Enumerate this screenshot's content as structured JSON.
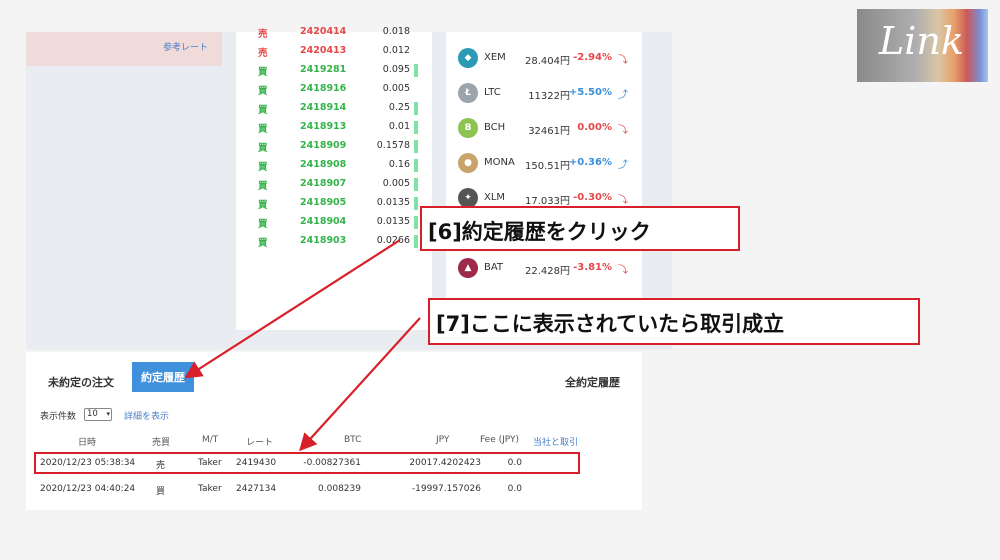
{
  "header_card": {
    "ref_label": "参考レート"
  },
  "recent_trades": [
    {
      "side": "売",
      "type": "sell",
      "price": "2420414",
      "qty": "0.018",
      "bar": false
    },
    {
      "side": "売",
      "type": "sell",
      "price": "2420413",
      "qty": "0.012",
      "bar": false
    },
    {
      "side": "買",
      "type": "buy",
      "price": "2419281",
      "qty": "0.095",
      "bar": true
    },
    {
      "side": "買",
      "type": "buy",
      "price": "2418916",
      "qty": "0.005",
      "bar": false
    },
    {
      "side": "買",
      "type": "buy",
      "price": "2418914",
      "qty": "0.25",
      "bar": true
    },
    {
      "side": "買",
      "type": "buy",
      "price": "2418913",
      "qty": "0.01",
      "bar": true
    },
    {
      "side": "買",
      "type": "buy",
      "price": "2418909",
      "qty": "0.1578",
      "bar": true
    },
    {
      "side": "買",
      "type": "buy",
      "price": "2418908",
      "qty": "0.16",
      "bar": true
    },
    {
      "side": "買",
      "type": "buy",
      "price": "2418907",
      "qty": "0.005",
      "bar": true
    },
    {
      "side": "買",
      "type": "buy",
      "price": "2418905",
      "qty": "0.0135",
      "bar": true
    },
    {
      "side": "買",
      "type": "buy",
      "price": "2418904",
      "qty": "0.0135",
      "bar": true
    },
    {
      "side": "買",
      "type": "buy",
      "price": "2418903",
      "qty": "0.0266",
      "bar": true
    }
  ],
  "market": [
    {
      "symbol": "XEM",
      "price": "28.404円",
      "change": "-2.94%",
      "dir": "down",
      "icon_color": "#2b9ab5"
    },
    {
      "symbol": "LTC",
      "price": "11322円",
      "change": "+5.50%",
      "dir": "up",
      "icon_color": "#9ba3ad"
    },
    {
      "symbol": "BCH",
      "price": "32461円",
      "change": "0.00%",
      "dir": "down",
      "icon_color": "#8dc351"
    },
    {
      "symbol": "MONA",
      "price": "150.51円",
      "change": "+0.36%",
      "dir": "up",
      "icon_color": "#c9a46a"
    },
    {
      "symbol": "XLM",
      "price": "17.033円",
      "change": "-0.30%",
      "dir": "down",
      "icon_color": "#555555"
    },
    {
      "symbol": "BAT",
      "price": "22.428円",
      "change": "-3.81%",
      "dir": "down",
      "icon_color": "#9e2a4a"
    }
  ],
  "orders": {
    "tab_open": "未約定の注文",
    "tab_history": "約定履歴",
    "all_history": "全約定履歴",
    "display_count_label": "表示件数",
    "display_count_value": "10",
    "detail_link": "詳細を表示",
    "columns": [
      "日時",
      "売買",
      "M/T",
      "レート",
      "BTC",
      "JPY",
      "Fee (JPY)",
      "当社と取引"
    ],
    "rows": [
      {
        "date": "2020/12/23 05:38:34",
        "side": "売",
        "type": "sell",
        "mt": "Taker",
        "rate": "2419430",
        "btc": "-0.00827361",
        "jpy": "20017.4202423",
        "fee": "0.0"
      },
      {
        "date": "2020/12/23 04:40:24",
        "side": "買",
        "type": "buy",
        "mt": "Taker",
        "rate": "2427134",
        "btc": "0.008239",
        "jpy": "-19997.157026",
        "fee": "0.0"
      }
    ]
  },
  "callouts": {
    "step6": "[6]約定履歴をクリック",
    "step7": "[7]ここに表示されていたら取引成立"
  },
  "logo_text": "Link",
  "colors": {
    "accent": "#3f91dc",
    "callout_red": "#d8202a",
    "sell": "#e54848",
    "buy": "#35b34a"
  }
}
